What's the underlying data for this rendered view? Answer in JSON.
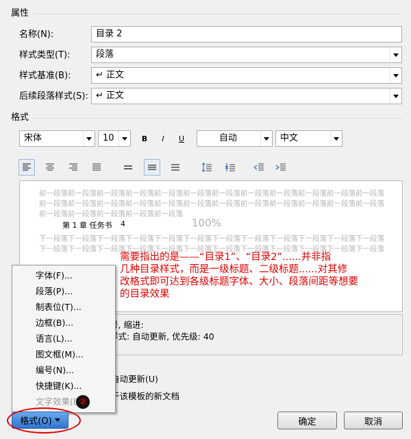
{
  "properties": {
    "title": "属性",
    "name_label": "名称(N):",
    "name_value": "目录 2",
    "style_type_label": "样式类型(T):",
    "style_type_value": "段落",
    "style_based_on_label": "样式基准(B):",
    "style_based_on_value": "↵ 正文",
    "next_style_label": "后续段落样式(S):",
    "next_style_value": "↵ 正文"
  },
  "format": {
    "title": "格式",
    "font_name": "宋体",
    "font_size": "10",
    "bold_label": "B",
    "italic_label": "I",
    "underline_label": "U",
    "font_color": "自动",
    "language": "中文"
  },
  "preview": {
    "prev_para_lines": [
      "前一段落前一段落前一段落前一段落前一段落前一段落前一段落前一段落前一段落前一段落前一段落前一段落",
      "前一段落前一段落前一段落前一段落前一段落前一段落前一段落前一段落前一段落前一段落前一段落前一段落",
      "前一段落前一段落前一段落前一段落前一段落"
    ],
    "sample_text": "第 1 章 任务书",
    "sample_page": "4",
    "zoom": "100%",
    "next_para_lines": [
      "下一段落下一段落下一段落下一段落下一段落下一段落下一段落下一段落下一段落下一段落下一段落下一段落",
      "下一段落下一段落下一段落下一段落下一段落下一段落下一段落下一段落下一段落下一段落下一段落下一段落"
    ]
  },
  "annotation": {
    "line1": "需要指出的是——“目录1”、“目录2”......并非指",
    "line2": "几种目录样式，而是一级标题、二级标题......对其修",
    "line3": "改格式即可达到各级标题字体、大小、段落间距等想要",
    "line4": "的目录效果",
    "circle_number": "②"
  },
  "description": {
    "line1": "号, 缩进:",
    "line2": "样式: 自动更新, 优先级: 40"
  },
  "options": {
    "auto_update": "自动更新(U)",
    "template_doc": "于该模板的新文档"
  },
  "context_menu": {
    "items": [
      "字体(F)...",
      "段落(P)...",
      "制表位(T)...",
      "边框(B)...",
      "语言(L)...",
      "图文框(M)...",
      "编号(N)...",
      "快捷键(K)...",
      "文字效果(E)..."
    ]
  },
  "buttons": {
    "format": "格式(O)",
    "ok": "确定",
    "cancel": "取消"
  },
  "colors": {
    "annotation_red": "#e00000",
    "button_blue": "#3c7fd6"
  }
}
